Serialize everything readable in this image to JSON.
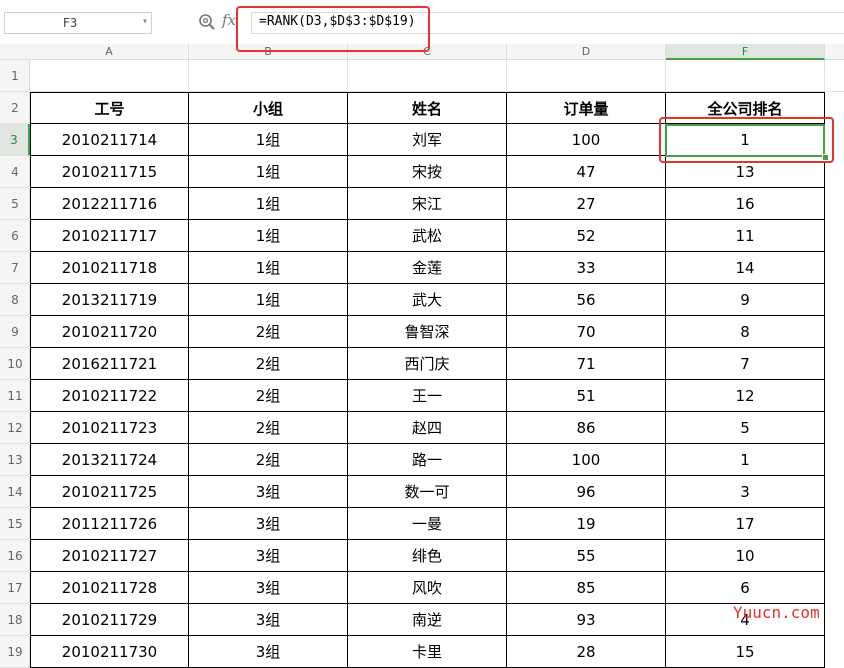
{
  "formula_bar": {
    "cell_ref": "F3",
    "formula": "=RANK(D3,$D$3:$D$19)",
    "fx_label": "fx"
  },
  "columns": [
    "A",
    "B",
    "C",
    "D",
    "F"
  ],
  "rows": [
    "1",
    "2",
    "3",
    "4",
    "5",
    "6",
    "7",
    "8",
    "9",
    "10",
    "11",
    "12",
    "13",
    "14",
    "15",
    "16",
    "17",
    "18",
    "19"
  ],
  "table": {
    "headers": [
      "工号",
      "小组",
      "姓名",
      "订单量",
      "全公司排名"
    ],
    "rows": [
      [
        "2010211714",
        "1组",
        "刘军",
        "100",
        "1"
      ],
      [
        "2010211715",
        "1组",
        "宋按",
        "47",
        "13"
      ],
      [
        "2012211716",
        "1组",
        "宋江",
        "27",
        "16"
      ],
      [
        "2010211717",
        "1组",
        "武松",
        "52",
        "11"
      ],
      [
        "2010211718",
        "1组",
        "金莲",
        "33",
        "14"
      ],
      [
        "2013211719",
        "1组",
        "武大",
        "56",
        "9"
      ],
      [
        "2010211720",
        "2组",
        "鲁智深",
        "70",
        "8"
      ],
      [
        "2016211721",
        "2组",
        "西门庆",
        "71",
        "7"
      ],
      [
        "2010211722",
        "2组",
        "王一",
        "51",
        "12"
      ],
      [
        "2010211723",
        "2组",
        "赵四",
        "86",
        "5"
      ],
      [
        "2013211724",
        "2组",
        "路一",
        "100",
        "1"
      ],
      [
        "2010211725",
        "3组",
        "数一可",
        "96",
        "3"
      ],
      [
        "2011211726",
        "3组",
        "一曼",
        "19",
        "17"
      ],
      [
        "2010211727",
        "3组",
        "绯色",
        "55",
        "10"
      ],
      [
        "2010211728",
        "3组",
        "风吹",
        "85",
        "6"
      ],
      [
        "2010211729",
        "3组",
        "南逆",
        "93",
        "4"
      ],
      [
        "2010211730",
        "3组",
        "卡里",
        "28",
        "15"
      ]
    ]
  },
  "watermark": "Yuucn.com",
  "colors": {
    "selection": "#3ea447",
    "highlight_box": "#e8322b"
  }
}
